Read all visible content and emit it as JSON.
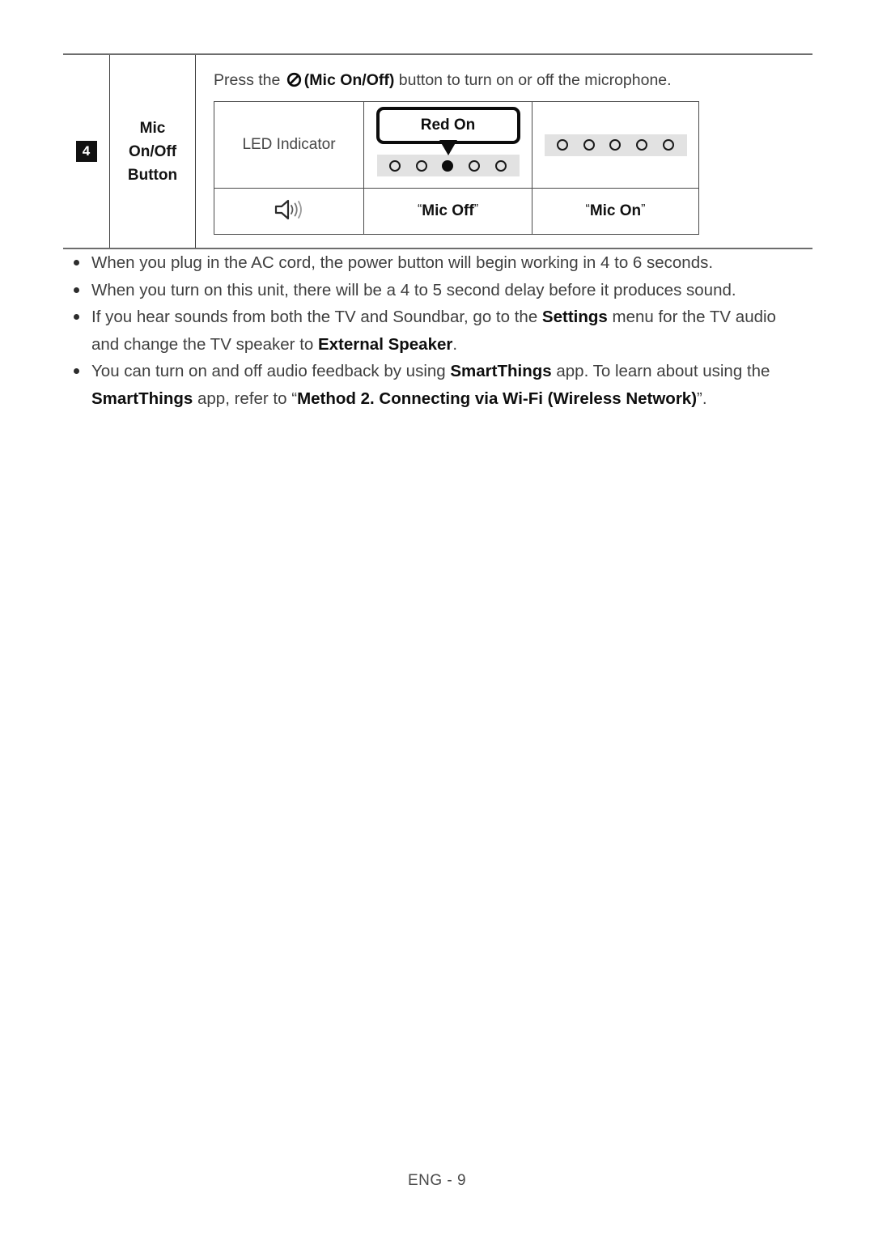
{
  "feature": {
    "number": "4",
    "label_lines": [
      "Mic",
      "On/Off",
      "Button"
    ],
    "instruction": {
      "prefix": "Press the ",
      "icon": "mic-off-icon",
      "bold_part": "(Mic On/Off)",
      "suffix": " button to turn on or off the microphone."
    },
    "led_table": {
      "row_header": "LED Indicator",
      "speaker_icon": "speaker-sound-icon",
      "mic_off": {
        "callout": "Red On",
        "caption_open_quote": "“",
        "caption": "Mic Off",
        "caption_close_quote": "”",
        "leds": [
          "off",
          "off",
          "on",
          "off",
          "off"
        ]
      },
      "mic_on": {
        "caption_open_quote": "“",
        "caption": "Mic On",
        "caption_close_quote": "”",
        "leds": [
          "off",
          "off",
          "off",
          "off",
          "off"
        ]
      }
    }
  },
  "notes": {
    "bullet_1": "When you plug in the AC cord, the power button will begin working in 4 to 6 seconds.",
    "bullet_2": "When you turn on this unit, there will be a 4 to 5 second delay before it produces sound.",
    "bullet_3": {
      "t1": "If you hear sounds from both the TV and Soundbar, go to the ",
      "b1": "Settings",
      "t2": " menu for the TV audio and change the TV speaker to ",
      "b2": "External Speaker",
      "t3": "."
    },
    "bullet_4": {
      "t1": "You can turn on and off audio feedback by using ",
      "b1": "SmartThings",
      "t2": " app. To learn about using the ",
      "b2": "SmartThings",
      "t3": " app, refer to “",
      "b3": "Method 2. Connecting via Wi-Fi (Wireless Network)",
      "t4": "”."
    }
  },
  "footer": {
    "page_label": "ENG - 9"
  },
  "colors": {
    "text": "#3f3f3f",
    "bold_text": "#0e0e0e",
    "rule": "#6d6d6d",
    "led_strip_bg": "#e2e2e2",
    "badge_bg": "#111111"
  }
}
